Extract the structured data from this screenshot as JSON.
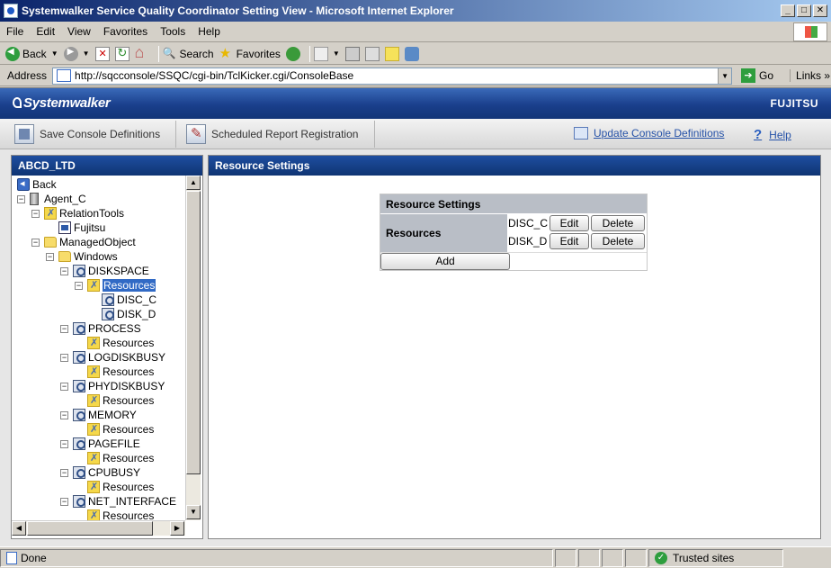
{
  "window": {
    "title": "Systemwalker Service Quality Coordinator Setting View - Microsoft Internet Explorer",
    "buttons": {
      "minimize": "_",
      "maximize": "□",
      "close": "✕"
    }
  },
  "menu": [
    "File",
    "Edit",
    "View",
    "Favorites",
    "Tools",
    "Help"
  ],
  "toolbar": {
    "back": "Back",
    "search": "Search",
    "favorites": "Favorites"
  },
  "address": {
    "label": "Address",
    "url": "http://sqcconsole/SSQC/cgi-bin/TclKicker.cgi/ConsoleBase",
    "go": "Go",
    "links": "Links",
    "links_chevron": "»"
  },
  "app": {
    "brand": "Systemwalker",
    "vendor": "FUJITSU",
    "actions": {
      "save": "Save Console Definitions",
      "report": "Scheduled Report Registration",
      "update": "Update Console Definitions",
      "help": "Help"
    }
  },
  "left_panel": {
    "title": "ABCD_LTD",
    "tree": [
      {
        "label": "Back"
      },
      {
        "label": "Agent_C"
      },
      {
        "label": "RelationTools"
      },
      {
        "label": "Fujitsu"
      },
      {
        "label": "ManagedObject"
      },
      {
        "label": "Windows"
      },
      {
        "label": "DISKSPACE"
      },
      {
        "label": "Resources"
      },
      {
        "label": "DISC_C"
      },
      {
        "label": "DISK_D"
      },
      {
        "label": "PROCESS"
      },
      {
        "label": "Resources"
      },
      {
        "label": "LOGDISKBUSY"
      },
      {
        "label": "Resources"
      },
      {
        "label": "PHYDISKBUSY"
      },
      {
        "label": "Resources"
      },
      {
        "label": "MEMORY"
      },
      {
        "label": "Resources"
      },
      {
        "label": "PAGEFILE"
      },
      {
        "label": "Resources"
      },
      {
        "label": "CPUBUSY"
      },
      {
        "label": "Resources"
      },
      {
        "label": "NET_INTERFACE"
      },
      {
        "label": "Resources"
      }
    ]
  },
  "right_panel": {
    "title": "Resource Settings",
    "table": {
      "header": "Resource Settings",
      "row_label": "Resources",
      "entries": [
        {
          "name": "DISC_C",
          "edit": "Edit",
          "delete": "Delete"
        },
        {
          "name": "DISK_D",
          "edit": "Edit",
          "delete": "Delete"
        }
      ],
      "add": "Add"
    }
  },
  "status": {
    "text": "Done",
    "zone": "Trusted sites"
  }
}
